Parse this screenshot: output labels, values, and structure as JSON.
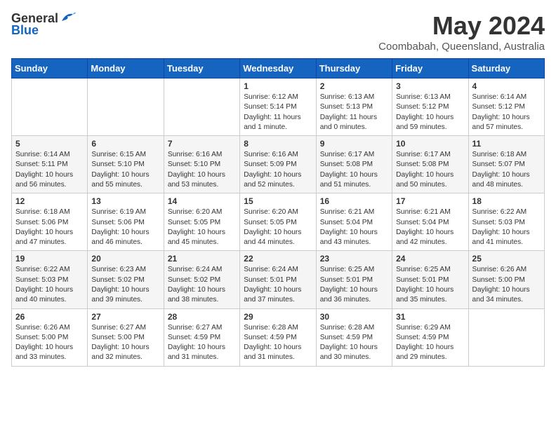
{
  "header": {
    "logo_general": "General",
    "logo_blue": "Blue",
    "month_title": "May 2024",
    "subtitle": "Coombabah, Queensland, Australia"
  },
  "days_of_week": [
    "Sunday",
    "Monday",
    "Tuesday",
    "Wednesday",
    "Thursday",
    "Friday",
    "Saturday"
  ],
  "weeks": [
    [
      {
        "day": "",
        "info": ""
      },
      {
        "day": "",
        "info": ""
      },
      {
        "day": "",
        "info": ""
      },
      {
        "day": "1",
        "info": "Sunrise: 6:12 AM\nSunset: 5:14 PM\nDaylight: 11 hours\nand 1 minute."
      },
      {
        "day": "2",
        "info": "Sunrise: 6:13 AM\nSunset: 5:13 PM\nDaylight: 11 hours\nand 0 minutes."
      },
      {
        "day": "3",
        "info": "Sunrise: 6:13 AM\nSunset: 5:12 PM\nDaylight: 10 hours\nand 59 minutes."
      },
      {
        "day": "4",
        "info": "Sunrise: 6:14 AM\nSunset: 5:12 PM\nDaylight: 10 hours\nand 57 minutes."
      }
    ],
    [
      {
        "day": "5",
        "info": "Sunrise: 6:14 AM\nSunset: 5:11 PM\nDaylight: 10 hours\nand 56 minutes."
      },
      {
        "day": "6",
        "info": "Sunrise: 6:15 AM\nSunset: 5:10 PM\nDaylight: 10 hours\nand 55 minutes."
      },
      {
        "day": "7",
        "info": "Sunrise: 6:16 AM\nSunset: 5:10 PM\nDaylight: 10 hours\nand 53 minutes."
      },
      {
        "day": "8",
        "info": "Sunrise: 6:16 AM\nSunset: 5:09 PM\nDaylight: 10 hours\nand 52 minutes."
      },
      {
        "day": "9",
        "info": "Sunrise: 6:17 AM\nSunset: 5:08 PM\nDaylight: 10 hours\nand 51 minutes."
      },
      {
        "day": "10",
        "info": "Sunrise: 6:17 AM\nSunset: 5:08 PM\nDaylight: 10 hours\nand 50 minutes."
      },
      {
        "day": "11",
        "info": "Sunrise: 6:18 AM\nSunset: 5:07 PM\nDaylight: 10 hours\nand 48 minutes."
      }
    ],
    [
      {
        "day": "12",
        "info": "Sunrise: 6:18 AM\nSunset: 5:06 PM\nDaylight: 10 hours\nand 47 minutes."
      },
      {
        "day": "13",
        "info": "Sunrise: 6:19 AM\nSunset: 5:06 PM\nDaylight: 10 hours\nand 46 minutes."
      },
      {
        "day": "14",
        "info": "Sunrise: 6:20 AM\nSunset: 5:05 PM\nDaylight: 10 hours\nand 45 minutes."
      },
      {
        "day": "15",
        "info": "Sunrise: 6:20 AM\nSunset: 5:05 PM\nDaylight: 10 hours\nand 44 minutes."
      },
      {
        "day": "16",
        "info": "Sunrise: 6:21 AM\nSunset: 5:04 PM\nDaylight: 10 hours\nand 43 minutes."
      },
      {
        "day": "17",
        "info": "Sunrise: 6:21 AM\nSunset: 5:04 PM\nDaylight: 10 hours\nand 42 minutes."
      },
      {
        "day": "18",
        "info": "Sunrise: 6:22 AM\nSunset: 5:03 PM\nDaylight: 10 hours\nand 41 minutes."
      }
    ],
    [
      {
        "day": "19",
        "info": "Sunrise: 6:22 AM\nSunset: 5:03 PM\nDaylight: 10 hours\nand 40 minutes."
      },
      {
        "day": "20",
        "info": "Sunrise: 6:23 AM\nSunset: 5:02 PM\nDaylight: 10 hours\nand 39 minutes."
      },
      {
        "day": "21",
        "info": "Sunrise: 6:24 AM\nSunset: 5:02 PM\nDaylight: 10 hours\nand 38 minutes."
      },
      {
        "day": "22",
        "info": "Sunrise: 6:24 AM\nSunset: 5:01 PM\nDaylight: 10 hours\nand 37 minutes."
      },
      {
        "day": "23",
        "info": "Sunrise: 6:25 AM\nSunset: 5:01 PM\nDaylight: 10 hours\nand 36 minutes."
      },
      {
        "day": "24",
        "info": "Sunrise: 6:25 AM\nSunset: 5:01 PM\nDaylight: 10 hours\nand 35 minutes."
      },
      {
        "day": "25",
        "info": "Sunrise: 6:26 AM\nSunset: 5:00 PM\nDaylight: 10 hours\nand 34 minutes."
      }
    ],
    [
      {
        "day": "26",
        "info": "Sunrise: 6:26 AM\nSunset: 5:00 PM\nDaylight: 10 hours\nand 33 minutes."
      },
      {
        "day": "27",
        "info": "Sunrise: 6:27 AM\nSunset: 5:00 PM\nDaylight: 10 hours\nand 32 minutes."
      },
      {
        "day": "28",
        "info": "Sunrise: 6:27 AM\nSunset: 4:59 PM\nDaylight: 10 hours\nand 31 minutes."
      },
      {
        "day": "29",
        "info": "Sunrise: 6:28 AM\nSunset: 4:59 PM\nDaylight: 10 hours\nand 31 minutes."
      },
      {
        "day": "30",
        "info": "Sunrise: 6:28 AM\nSunset: 4:59 PM\nDaylight: 10 hours\nand 30 minutes."
      },
      {
        "day": "31",
        "info": "Sunrise: 6:29 AM\nSunset: 4:59 PM\nDaylight: 10 hours\nand 29 minutes."
      },
      {
        "day": "",
        "info": ""
      }
    ]
  ]
}
